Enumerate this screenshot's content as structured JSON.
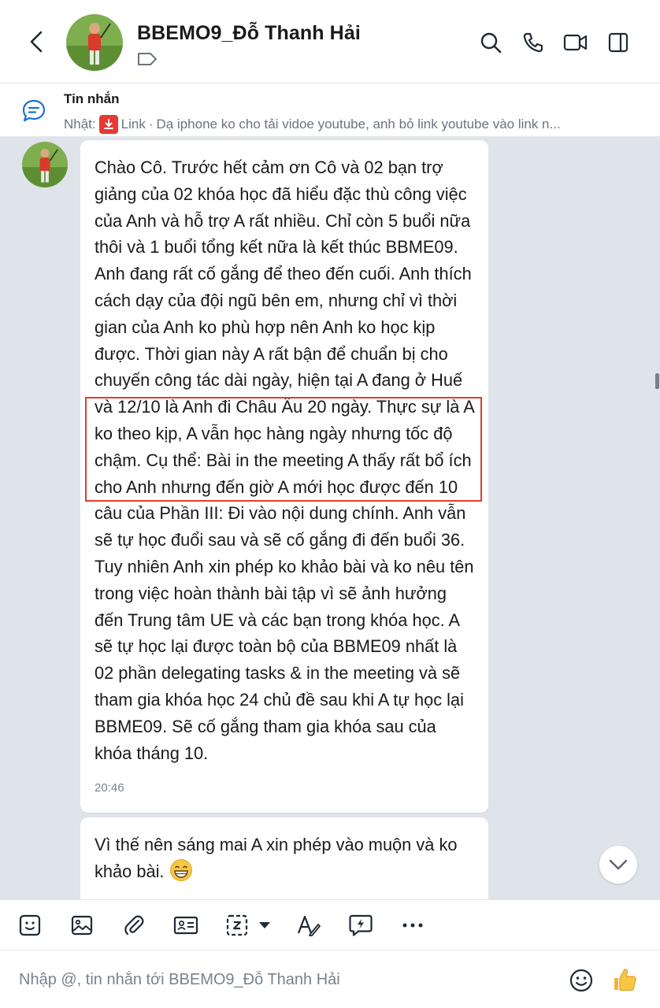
{
  "header": {
    "title": "BBEMO9_Đỗ Thanh Hải",
    "icons": [
      "back-arrow-icon",
      "tag-icon",
      "search-icon",
      "phone-icon",
      "video-call-icon",
      "sidebar-panel-icon"
    ]
  },
  "pinned": {
    "title": "Tin nhắn",
    "prefix": "Nhật:",
    "link_label": "Link",
    "separator": "·",
    "preview": "Dạ iphone ko cho tải vidoe youtube, anh bỏ link youtube vào link n..."
  },
  "messages": [
    {
      "text": "Chào Cô. Trước hết cảm ơn Cô và 02 bạn trợ giảng của 02 khóa học đã hiểu đặc thù công việc của Anh và hỗ trợ A rất nhiều. Chỉ còn 5 buổi nữa thôi và 1 buổi tổng kết nữa là kết thúc BBME09. Anh đang rất cố gắng để theo đến cuối. Anh thích cách dạy của đội ngũ bên em, nhưng chỉ vì thời gian của Anh ko phù hợp nên Anh ko học kịp được. Thời gian này A rất bận để chuẩn bị cho chuyến công tác dài ngày, hiện tại A đang ở Huế và 12/10 là Anh đi Châu Âu 20 ngày. Thực sự là A ko theo kịp, A vẫn học hàng ngày nhưng tốc độ chậm. Cụ thể: Bài in the meeting A thấy rất bổ ích cho Anh nhưng đến giờ A mới học được đến 10 câu của Phần III: Đi vào nội dung chính. Anh vẫn sẽ tự học đuổi sau và sẽ cố gắng đi đến buổi 36. Tuy nhiên Anh xin phép ko khảo bài và ko nêu tên trong việc hoàn thành bài tập vì sẽ ảnh hưởng đến Trung tâm UE và các bạn trong khóa học. A sẽ tự học lại được toàn bộ của BBME09 nhất là 02 phần delegating tasks & in the meeting và sẽ tham gia khóa học 24 chủ đề sau khi A tự học lại BBME09. Sẽ cố gắng tham gia khóa sau của khóa tháng 10.",
      "time": "20:46"
    },
    {
      "text": "Vì thế nên sáng mai A xin phép vào muộn và ko khảo bài.",
      "emoji": "grinning-face-emoji"
    }
  ],
  "toolbar": {
    "icons": [
      "sticker-icon",
      "image-icon",
      "attachment-icon",
      "contact-card-icon",
      "screenshot-icon",
      "dropdown-caret-icon",
      "text-format-icon",
      "quick-message-icon",
      "more-icon"
    ]
  },
  "composer": {
    "placeholder": "Nhập @, tin nhắn tới BBEMO9_Đỗ Thanh Hải"
  },
  "colors": {
    "highlight_border": "#e23b2e",
    "chat_background": "#dfe3ea",
    "icon_color": "#1f2a36",
    "pdf_badge": "#e53935"
  }
}
